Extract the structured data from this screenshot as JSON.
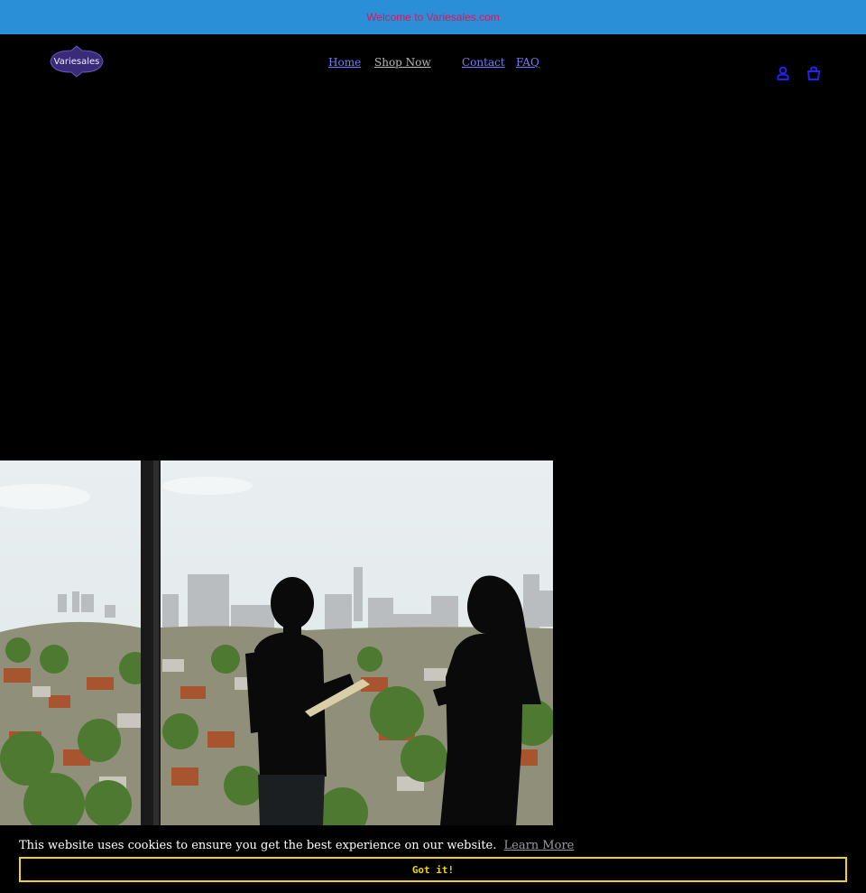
{
  "announcement": {
    "text": "Welcome to Variesales.com"
  },
  "header": {
    "logo_text": "Variesales",
    "nav": [
      {
        "label": "Home"
      },
      {
        "label": "Shop Now"
      },
      {
        "label": "Contact"
      },
      {
        "label": "FAQ"
      }
    ],
    "icons": {
      "account": "account-icon",
      "cart": "cart-icon"
    }
  },
  "hero": {
    "image": "two-people-silhouette-city-view"
  },
  "cookie": {
    "message": "This website uses cookies to ensure you get the best experience on our website.",
    "learn_more": "Learn More",
    "button": "Got it!"
  },
  "colors": {
    "announcement_bg": "#2a8fd6",
    "announcement_text": "#d7195e",
    "nav_link": "#7a7aff",
    "icon": "#2222ee",
    "cookie_accent": "#f1d600"
  }
}
